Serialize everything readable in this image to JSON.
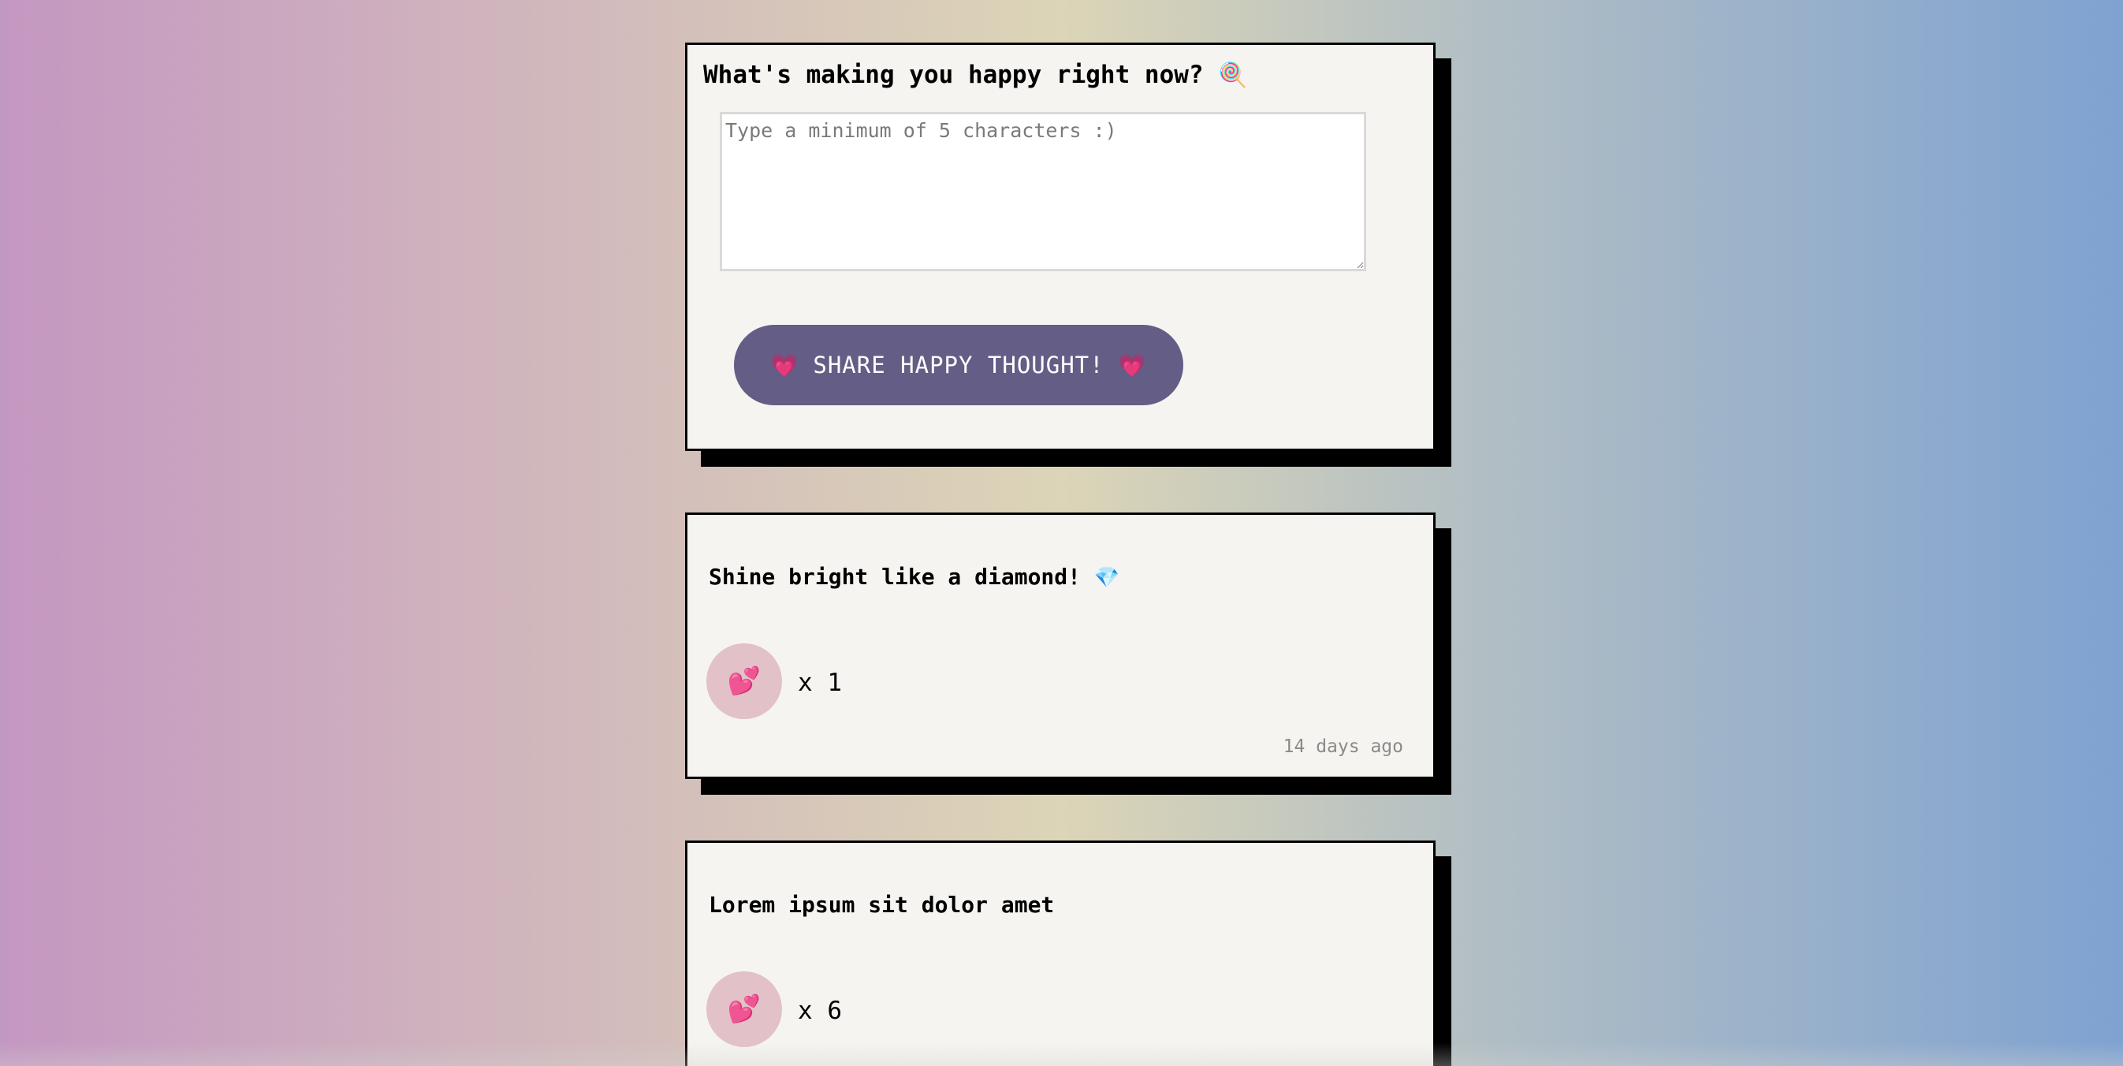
{
  "form": {
    "title": "What's making you happy right now?",
    "title_icon": "🍭",
    "textarea_placeholder": "Type a minimum of 5 characters :)",
    "textarea_value": "",
    "button_label": "SHARE HAPPY THOUGHT!",
    "button_icon": "💗"
  },
  "posts": [
    {
      "message": "Shine bright like a diamond!",
      "message_icon": "💎",
      "like_icon": "💕",
      "likes_label": "x 1",
      "time_ago": "14 days ago"
    },
    {
      "message": "Lorem ipsum sit dolor amet",
      "like_icon": "💕",
      "likes_label": "x 6"
    }
  ],
  "colors": {
    "button_bg": "#645d85",
    "card_bg": "#f5f4f0",
    "like_button_bg": "#e2c1c8",
    "shadow": "#000000"
  }
}
